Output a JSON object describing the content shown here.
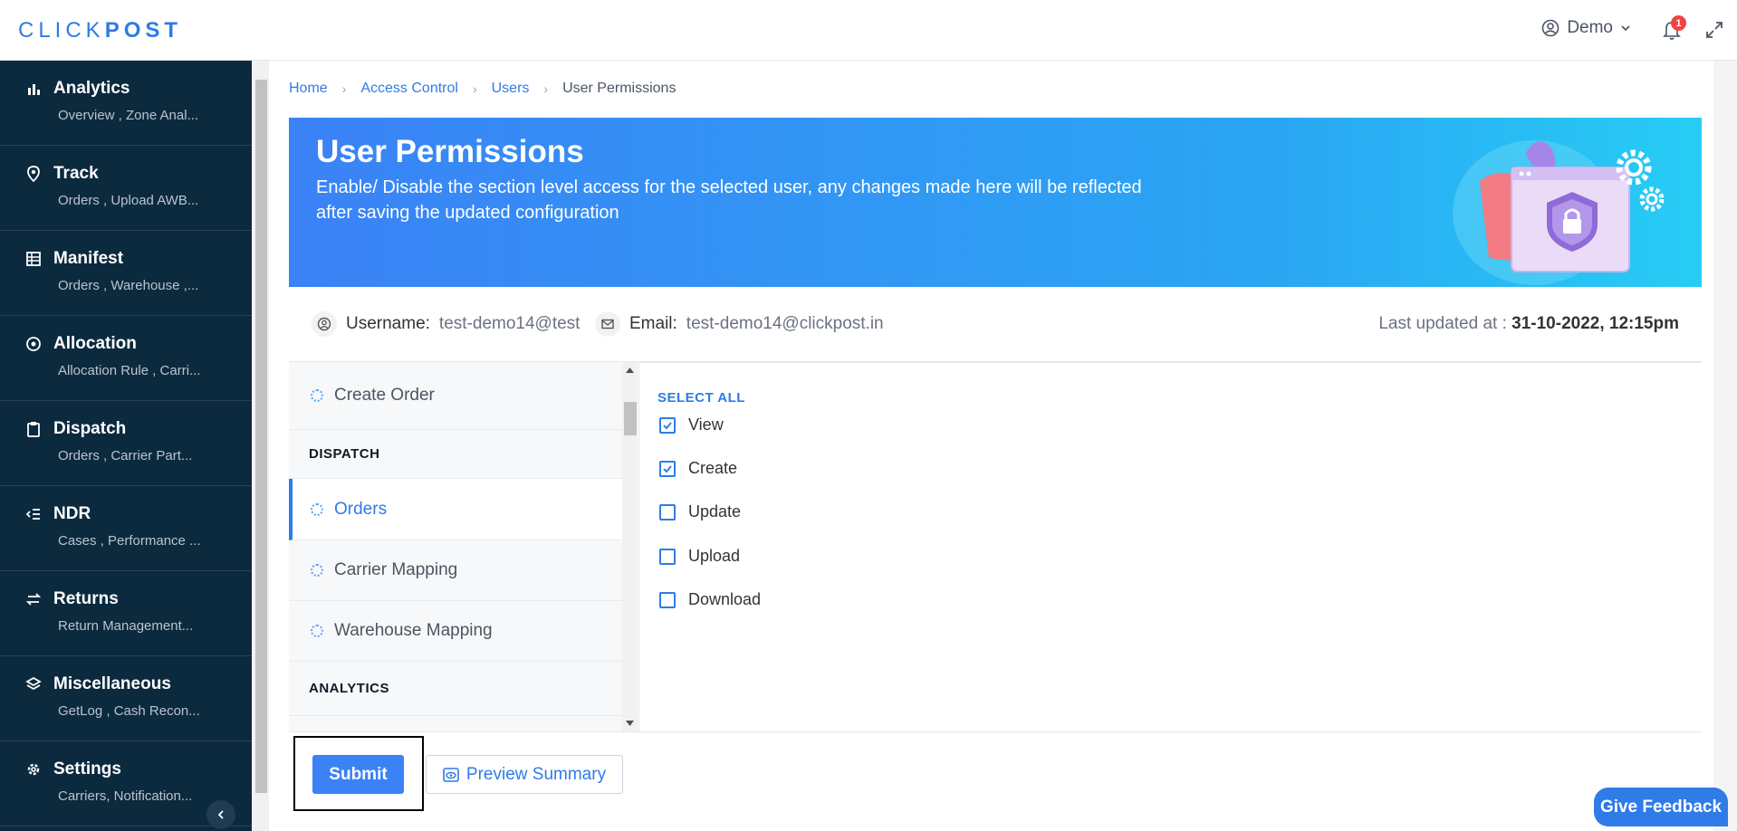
{
  "header": {
    "logo_light": "CLICK",
    "logo_bold": "POST",
    "user_name": "Demo",
    "notification_count": "1"
  },
  "sidebar": {
    "items": [
      {
        "title": "Analytics",
        "subtitle": "Overview , Zone Anal...",
        "icon": "bar-chart-icon"
      },
      {
        "title": "Track",
        "subtitle": "Orders , Upload AWB...",
        "icon": "location-pin-icon"
      },
      {
        "title": "Manifest",
        "subtitle": "Orders , Warehouse ,...",
        "icon": "table-icon"
      },
      {
        "title": "Allocation",
        "subtitle": "Allocation Rule , Carri...",
        "icon": "target-icon"
      },
      {
        "title": "Dispatch",
        "subtitle": "Orders , Carrier Part...",
        "icon": "clipboard-icon"
      },
      {
        "title": "NDR",
        "subtitle": "Cases , Performance ...",
        "icon": "list-return-icon"
      },
      {
        "title": "Returns",
        "subtitle": "Return Management...",
        "icon": "swap-arrows-icon"
      },
      {
        "title": "Miscellaneous",
        "subtitle": "GetLog , Cash Recon...",
        "icon": "layers-icon"
      },
      {
        "title": "Settings",
        "subtitle": "Carriers, Notification...",
        "icon": "gear-icon"
      }
    ]
  },
  "breadcrumb": {
    "home": "Home",
    "access_control": "Access Control",
    "users": "Users",
    "current": "User Permissions"
  },
  "banner": {
    "title": "User Permissions",
    "description": "Enable/ Disable the section level access for the selected user, any changes made here will be reflected after saving the updated configuration"
  },
  "info": {
    "username_label": "Username:",
    "username_value": "test-demo14@test",
    "email_label": "Email:",
    "email_value": "test-demo14@clickpost.in",
    "last_updated_label": "Last updated at : ",
    "last_updated_value": "31-10-2022, 12:15pm"
  },
  "sections": {
    "create_order": "Create Order",
    "dispatch_label": "DISPATCH",
    "orders": "Orders",
    "carrier_mapping": "Carrier Mapping",
    "warehouse_mapping": "Warehouse Mapping",
    "analytics_label": "ANALYTICS"
  },
  "permissions": {
    "select_all": "SELECT ALL",
    "items": [
      {
        "label": "View",
        "checked": true
      },
      {
        "label": "Create",
        "checked": true
      },
      {
        "label": "Update",
        "checked": false
      },
      {
        "label": "Upload",
        "checked": false
      },
      {
        "label": "Download",
        "checked": false
      }
    ]
  },
  "actions": {
    "submit": "Submit",
    "preview": "Preview Summary",
    "feedback": "Give Feedback"
  },
  "colors": {
    "accent": "#2f7be7",
    "sidebar_bg": "#0c2a3e"
  }
}
